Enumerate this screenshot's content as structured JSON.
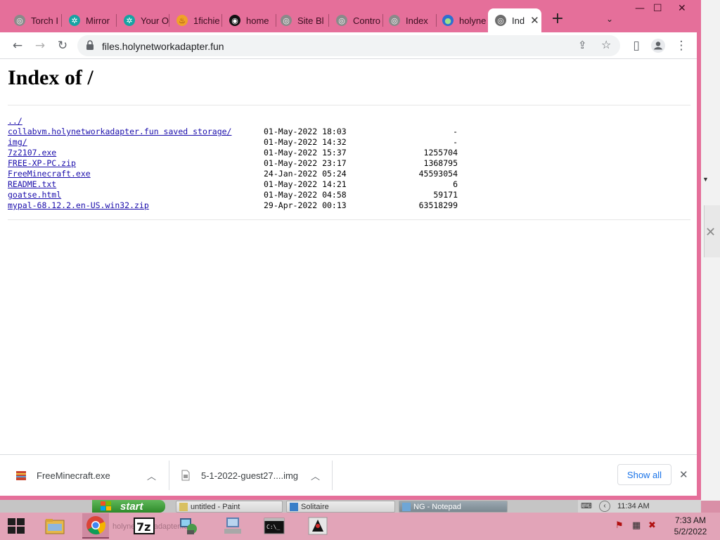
{
  "browser": {
    "tabs": [
      {
        "title": "Torch I",
        "favicon": "circle-gray"
      },
      {
        "title": "Mirror",
        "favicon": "gear-teal"
      },
      {
        "title": "Your O",
        "favicon": "gear-teal"
      },
      {
        "title": "1fichie",
        "favicon": "flame-orange"
      },
      {
        "title": "home",
        "favicon": "spiral-black"
      },
      {
        "title": "Site Bl",
        "favicon": "circle-gray"
      },
      {
        "title": "Contro",
        "favicon": "circle-gray"
      },
      {
        "title": "Index",
        "favicon": "circle-gray"
      },
      {
        "title": "holyne",
        "favicon": "globe-blue"
      }
    ],
    "active_tab": {
      "title": "Ind",
      "close": "✕"
    },
    "new_tab": "+",
    "tab_search": "⌄",
    "window_controls": {
      "minimize": "—",
      "maximize": "☐",
      "close": "✕"
    },
    "toolbar": {
      "back": "←",
      "forward": "→",
      "reload": "↻",
      "share": "⇪",
      "star": "☆",
      "sidebar": "▯",
      "menu": "⋮"
    },
    "url": "files.holynetworkadapter.fun",
    "accent": "#e56f9a"
  },
  "page": {
    "heading": "Index of /",
    "entries": [
      {
        "name": "../",
        "date": "",
        "size": ""
      },
      {
        "name": "collabvm.holynetworkadapter.fun saved storage/",
        "date": "01-May-2022 18:03",
        "size": "-"
      },
      {
        "name": "img/",
        "date": "01-May-2022 14:32",
        "size": "-"
      },
      {
        "name": "7z2107.exe",
        "date": "01-May-2022 15:37",
        "size": "1255704"
      },
      {
        "name": "FREE-XP-PC.zip",
        "date": "01-May-2022 23:17",
        "size": "1368795"
      },
      {
        "name": "FreeMinecraft.exe",
        "date": "24-Jan-2022 05:24",
        "size": "45593054"
      },
      {
        "name": "README.txt",
        "date": "01-May-2022 14:21",
        "size": "6"
      },
      {
        "name": "goatse.html",
        "date": "01-May-2022 04:58",
        "size": "59171"
      },
      {
        "name": "mypal-68.12.2.en-US.win32.zip",
        "date": "29-Apr-2022 00:13",
        "size": "63518299"
      }
    ]
  },
  "downloads": {
    "items": [
      {
        "name": "FreeMinecraft.exe"
      },
      {
        "name": "5-1-2022-guest27....img"
      }
    ],
    "show_all": "Show all",
    "close": "✕"
  },
  "xp_taskbar": {
    "start": "start",
    "tasks": [
      {
        "label": "untitled - Paint"
      },
      {
        "label": "Solitaire"
      },
      {
        "label": "NG - Notepad"
      }
    ],
    "clock": "11:34 AM"
  },
  "host_taskbar": {
    "pinned": [
      "windows-start",
      "file-explorer",
      "chrome",
      "7zip",
      "network-app",
      "vm-app",
      "command-prompt",
      "java-app"
    ],
    "ghost_text": "holynetworkadapter.fun",
    "time": "7:33 AM",
    "date": "5/2/2022"
  }
}
